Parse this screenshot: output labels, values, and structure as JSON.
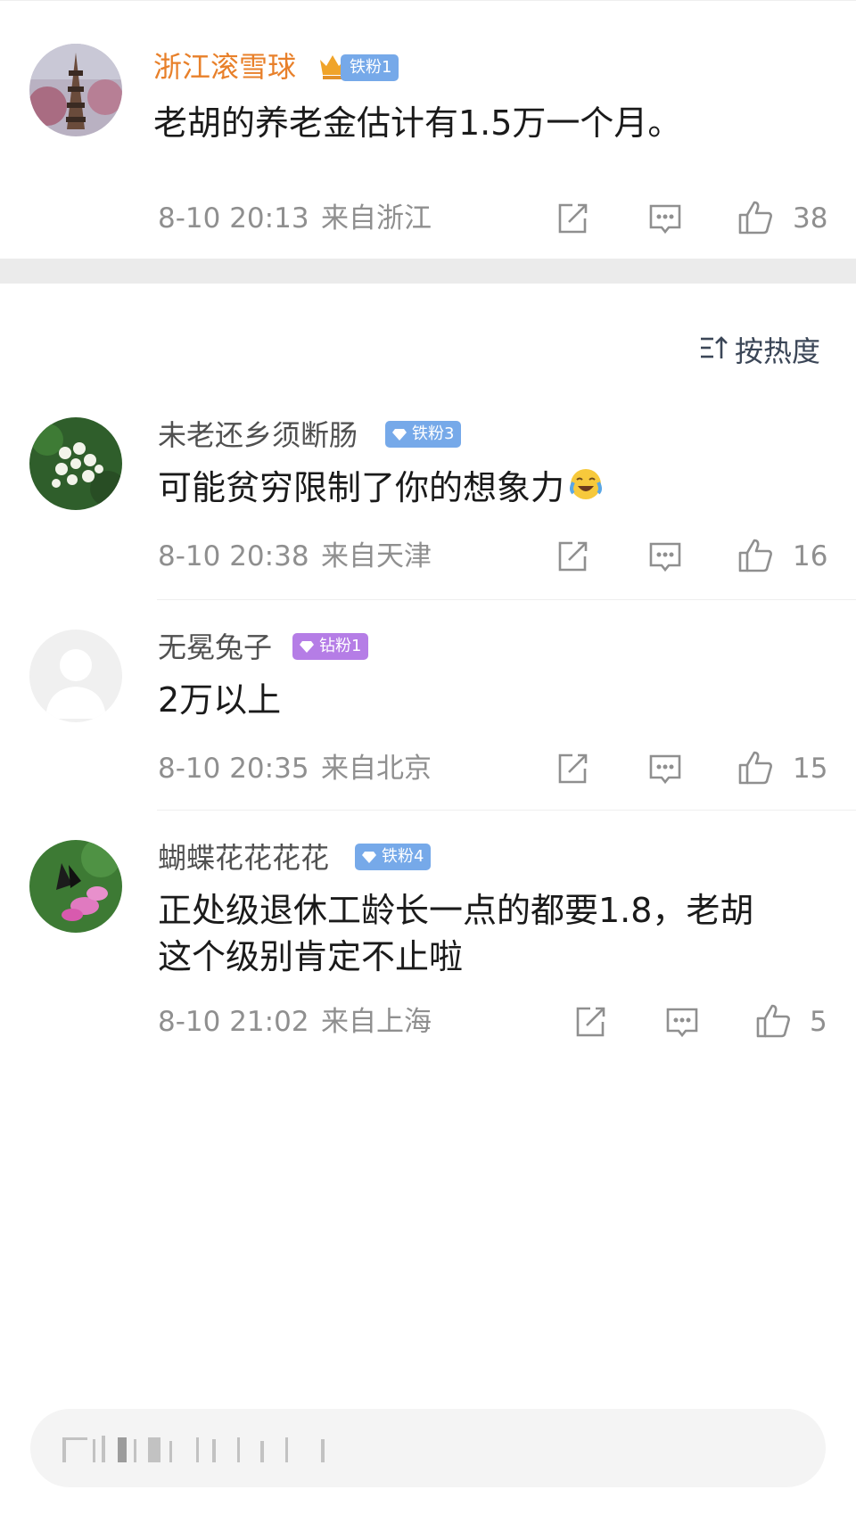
{
  "post": {
    "author": "浙江滚雪球",
    "badge": "铁粉1",
    "content": "老胡的养老金估计有1.5万一个月。",
    "time": "8-10 20:13",
    "location": "来自浙江",
    "likes": "38"
  },
  "sort_label": "按热度",
  "comments": [
    {
      "author": "未老还乡须断肠",
      "badge": "铁粉3",
      "content": "可能贫穷限制了你的想象力",
      "emoji": "laugh-cry-emoji",
      "time": "8-10 20:38",
      "location": "来自天津",
      "likes": "16"
    },
    {
      "author": "无冕兔子",
      "badge": "钻粉1",
      "content": "2万以上",
      "time": "8-10 20:35",
      "location": "来自北京",
      "likes": "15"
    },
    {
      "author": "蝴蝶花花花花",
      "badge": "铁粉4",
      "content_line1": "正处级退休工龄长一点的都要1.8，老胡",
      "content_line2": "这个级别肯定不止啦",
      "time": "8-10 21:02",
      "location": "来自上海",
      "likes": "5"
    }
  ],
  "colors": {
    "author_primary": "#e8802a",
    "author": "#505050",
    "badge_blue": "#76a9e9",
    "badge_purple": "#b57de6",
    "meta": "#8f8f8f"
  }
}
